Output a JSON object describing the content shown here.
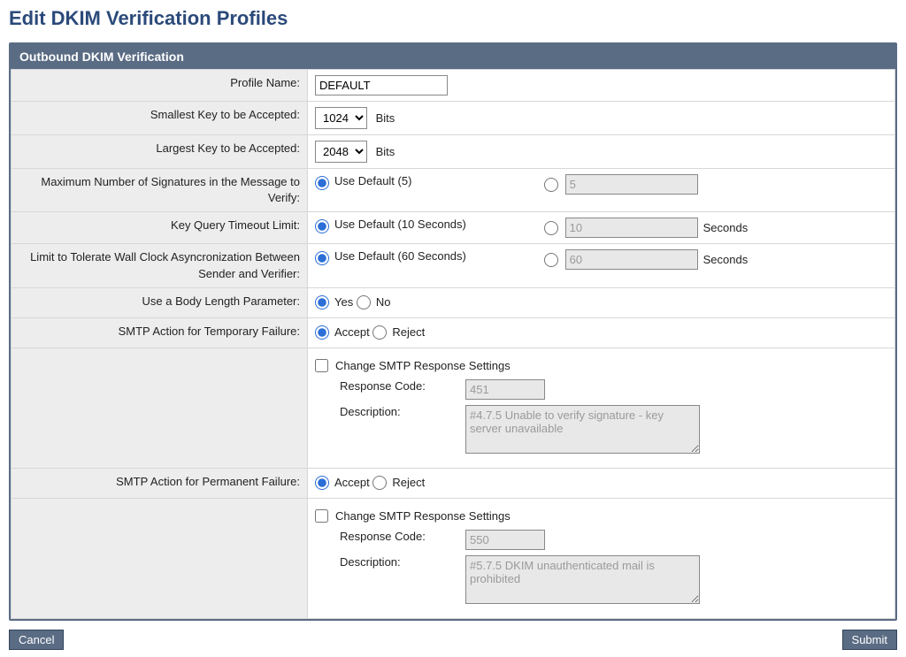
{
  "page": {
    "title": "Edit DKIM Verification Profiles"
  },
  "panel": {
    "header": "Outbound DKIM Verification"
  },
  "labels": {
    "profile_name": "Profile Name:",
    "smallest_key": "Smallest Key to be Accepted:",
    "largest_key": "Largest Key to be Accepted:",
    "max_sigs": "Maximum Number of Signatures in the Message to Verify:",
    "key_query_timeout": "Key Query Timeout Limit:",
    "clock_limit": "Limit to Tolerate Wall Clock Asyncronization Between Sender and Verifier:",
    "body_length": "Use a Body Length Parameter:",
    "temp_failure": "SMTP Action for Temporary Failure:",
    "perm_failure": "SMTP Action for Permanent Failure:",
    "change_smtp": "Change SMTP Response Settings",
    "response_code": "Response Code:",
    "description": "Description:"
  },
  "units": {
    "bits": "Bits",
    "seconds": "Seconds"
  },
  "options": {
    "use_default_5": "Use Default (5)",
    "use_default_10s": "Use Default (10 Seconds)",
    "use_default_60s": "Use Default (60 Seconds)",
    "yes": "Yes",
    "no": "No",
    "accept": "Accept",
    "reject": "Reject"
  },
  "values": {
    "profile_name": "DEFAULT",
    "smallest_key": "1024",
    "largest_key": "2048",
    "max_sigs_custom": "5",
    "key_query_custom": "10",
    "clock_limit_custom": "60",
    "temp_code": "451",
    "temp_desc": "#4.7.5 Unable to verify signature - key server unavailable",
    "perm_code": "550",
    "perm_desc": "#5.7.5 DKIM unauthenticated mail is prohibited"
  },
  "buttons": {
    "cancel": "Cancel",
    "submit": "Submit"
  }
}
